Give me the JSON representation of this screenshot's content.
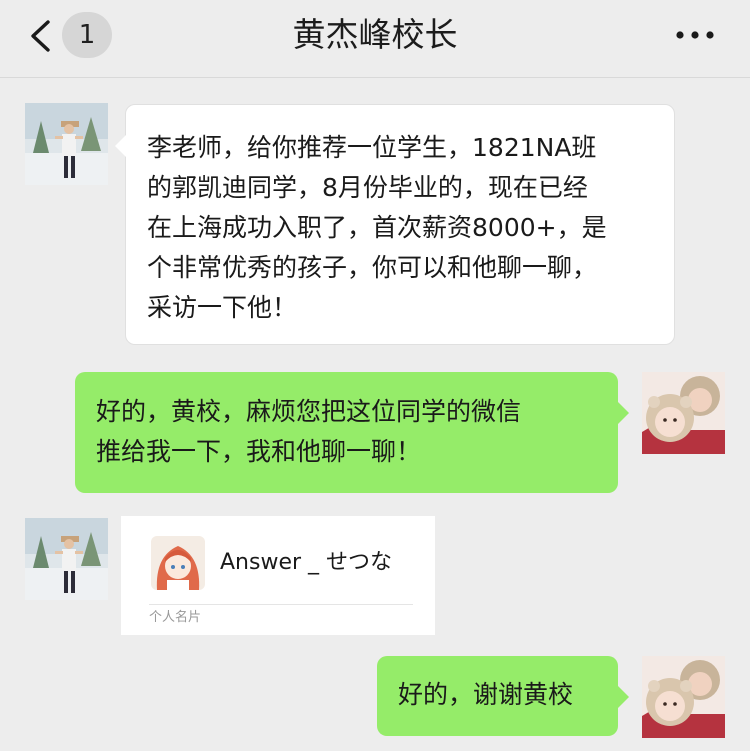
{
  "header": {
    "title": "黄杰峰校长",
    "unread_count": "1",
    "back_icon": "chevron-left-icon",
    "more_icon": "more-dots-icon"
  },
  "messages": [
    {
      "sender": "other",
      "lines": [
        "李老师，给你推荐一位学生，1821NA班",
        "的郭凯迪同学，8月份毕业的，现在已经",
        "在上海成功入职了，首次薪资8000+，是",
        "个非常优秀的孩子，你可以和他聊一聊，",
        "采访一下他！"
      ]
    },
    {
      "sender": "self",
      "lines": [
        "好的，黄校，麻烦您把这位同学的微信",
        "推给我一下，我和他聊一聊！"
      ]
    },
    {
      "sender": "other",
      "card": {
        "name": "Answer _ せつな",
        "type": "个人名片"
      }
    },
    {
      "sender": "self",
      "lines": [
        "好的，谢谢黄校"
      ]
    }
  ],
  "colors": {
    "background": "#ededed",
    "self_bubble": "#95ec69",
    "other_bubble": "#ffffff"
  }
}
